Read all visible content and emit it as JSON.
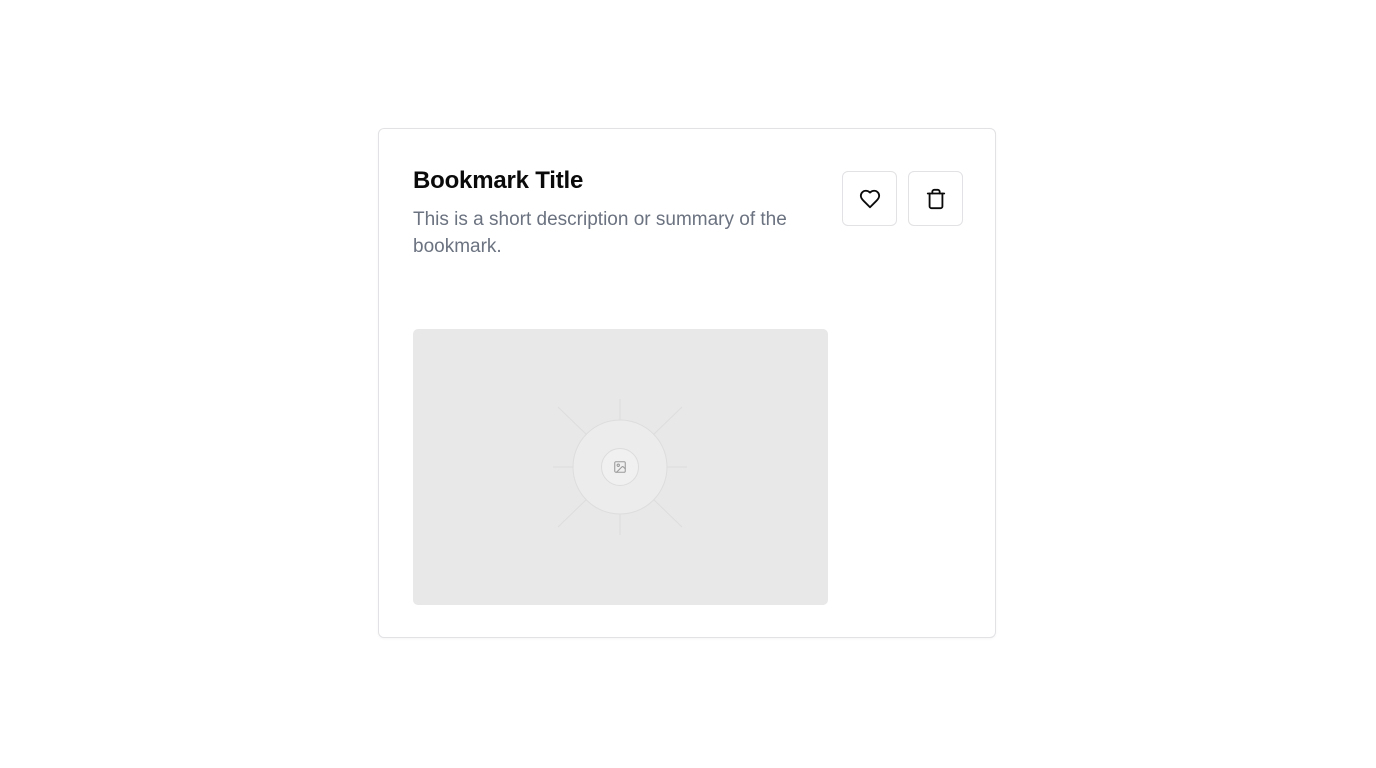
{
  "bookmark": {
    "title": "Bookmark Title",
    "description": "This is a short description or summary of the bookmark.",
    "like_button_icon": "heart-icon",
    "delete_button_icon": "trash-icon",
    "image_icon": "image-icon"
  },
  "colors": {
    "title": "#0a0a0a",
    "description": "#6b7280",
    "border": "#e2e2e5",
    "placeholder_bg": "#e8e8e8"
  }
}
